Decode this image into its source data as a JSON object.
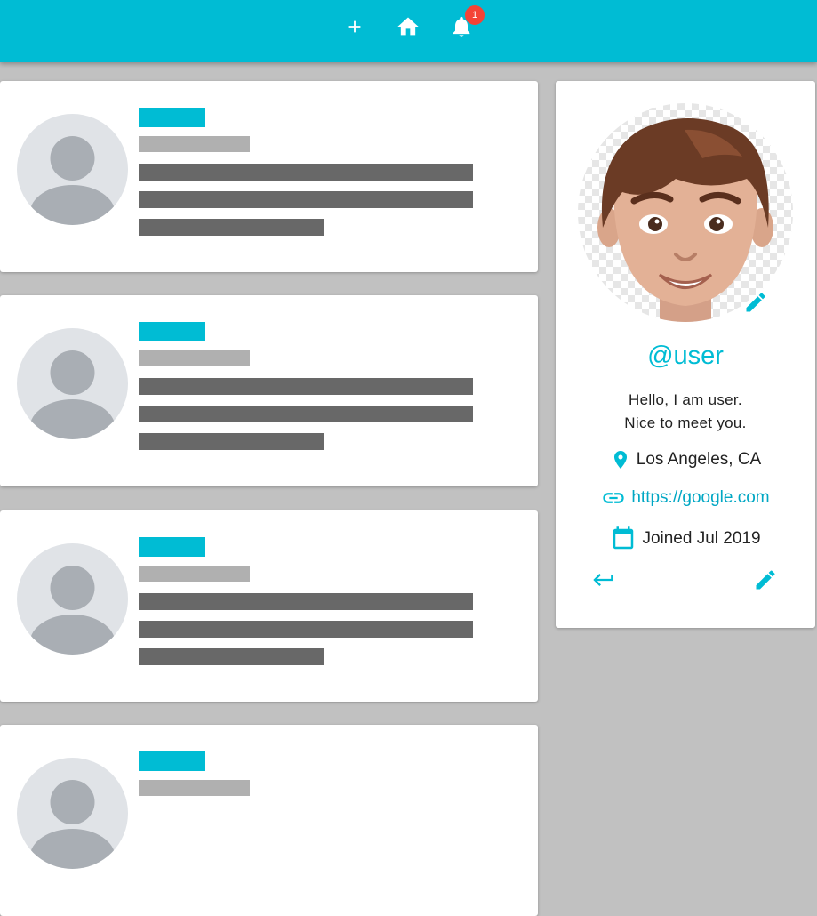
{
  "appbar": {
    "color": "#00bcd4",
    "icons": [
      "add-icon",
      "home-icon",
      "notifications-icon"
    ],
    "notification_count": "1"
  },
  "feed": {
    "loading_cards": 4
  },
  "profile": {
    "handle": "@user",
    "bio_line1": "Hello, I am user.",
    "bio_line2": "Nice to meet you.",
    "location": "Los Angeles, CA",
    "website": "https://google.com",
    "joined": "Joined Jul 2019"
  }
}
